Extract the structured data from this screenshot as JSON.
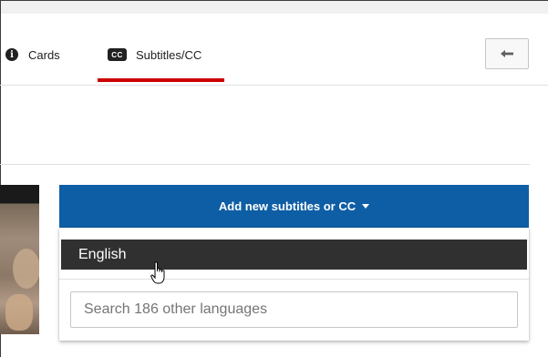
{
  "tabs": [
    {
      "label": "Cards",
      "icon": "info-icon"
    },
    {
      "label": "Subtitles/CC",
      "icon": "cc-icon",
      "active": true
    }
  ],
  "cc_badge": "CC",
  "info_glyph": "i",
  "back_button": {
    "icon": "back-arrow-icon"
  },
  "add_button": {
    "label": "Add new subtitles or CC",
    "icon": "caret-down-icon"
  },
  "dropdown": {
    "highlighted_language": "English",
    "search_placeholder": "Search 186 other languages"
  },
  "colors": {
    "accent_blue": "#0e5ea5",
    "active_tab_red": "#cc0000",
    "highlight_dark": "#303030"
  }
}
